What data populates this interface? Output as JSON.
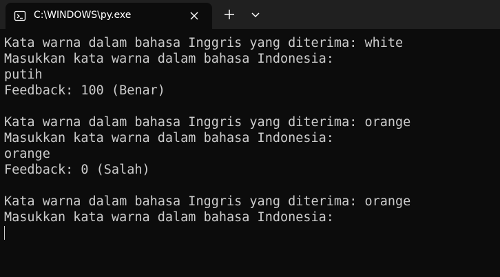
{
  "window": {
    "tab_title": "C:\\WINDOWS\\py.exe"
  },
  "icons": {
    "tab_icon": "terminal-icon",
    "close": "close-icon",
    "new_tab": "plus-icon",
    "dropdown": "chevron-down-icon"
  },
  "console": {
    "lines": [
      "Kata warna dalam bahasa Inggris yang diterima: white",
      "Masukkan kata warna dalam bahasa Indonesia:",
      "putih",
      "Feedback: 100 (Benar)",
      "",
      "Kata warna dalam bahasa Inggris yang diterima: orange",
      "Masukkan kata warna dalam bahasa Indonesia:",
      "orange",
      "Feedback: 0 (Salah)",
      "",
      "Kata warna dalam bahasa Inggris yang diterima: orange",
      "Masukkan kata warna dalam bahasa Indonesia:"
    ]
  },
  "colors": {
    "background": "#0c0c0c",
    "tabbar": "#202020",
    "text": "#cccccc"
  }
}
